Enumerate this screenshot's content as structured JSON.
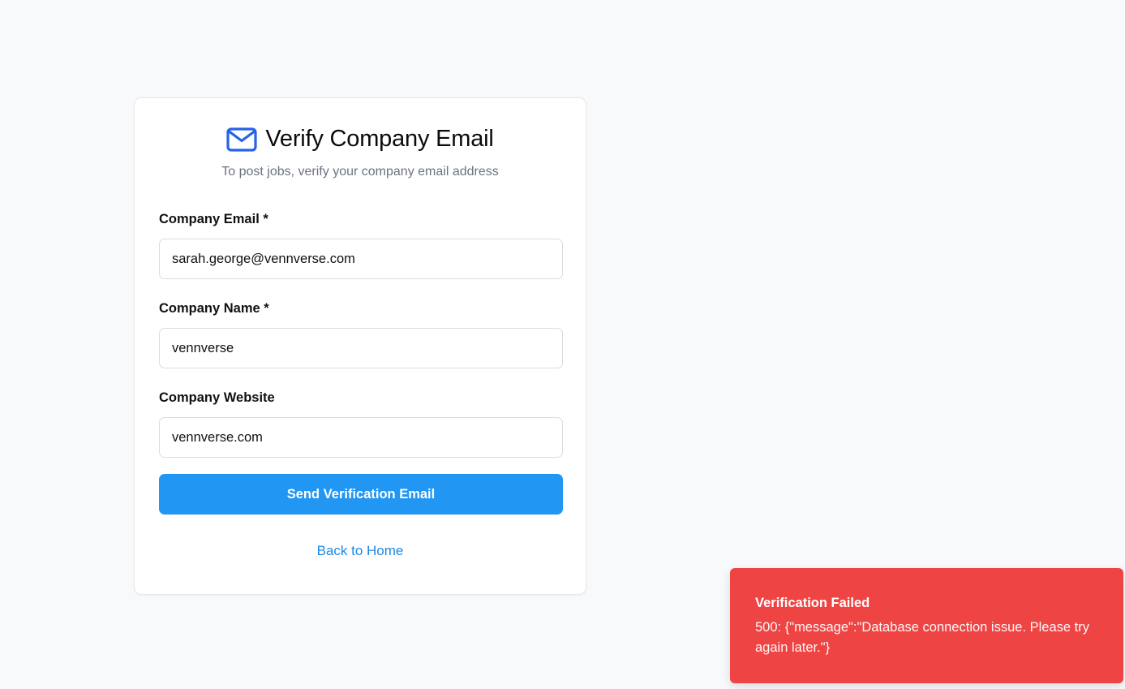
{
  "card": {
    "title": "Verify Company Email",
    "subtitle": "To post jobs, verify your company email address",
    "icon": "mail-icon",
    "icon_color": "#2563eb"
  },
  "form": {
    "company_email": {
      "label": "Company Email *",
      "value": "sarah.george@vennverse.com"
    },
    "company_name": {
      "label": "Company Name *",
      "value": "vennverse"
    },
    "company_website": {
      "label": "Company Website",
      "value": "vennverse.com"
    },
    "submit_label": "Send Verification Email",
    "submit_color": "#2196f3"
  },
  "back_link": "Back to Home",
  "toast": {
    "title": "Verification Failed",
    "message": "500: {\"message\":\"Database connection issue. Please try again later.\"}",
    "color": "#ef4444"
  }
}
